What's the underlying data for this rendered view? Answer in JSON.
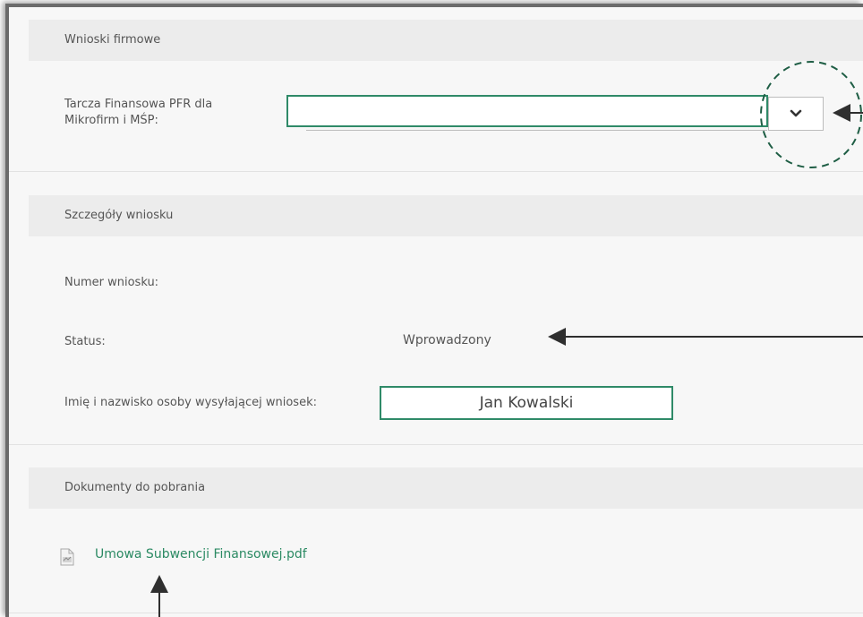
{
  "sections": {
    "company_applications": {
      "title": "Wnioski firmowe"
    },
    "application_details": {
      "title": "Szczegóły wniosku"
    },
    "documents": {
      "title": "Dokumenty do pobrania"
    }
  },
  "shield_select": {
    "label_line1": "Tarcza Finansowa PFR dla",
    "label_line2": "Mikrofirm i MŚP:",
    "value": "",
    "icon": "chevron-down-icon"
  },
  "details": {
    "number_label": "Numer wniosku:",
    "number_value": "",
    "status_label": "Status:",
    "status_value": "Wprowadzony",
    "sender_label": "Imię i nazwisko osoby wysyłającej wniosek:",
    "sender_value": "Jan Kowalski"
  },
  "documents": {
    "file_icon": "pdf-file-icon",
    "file_name": "Umowa Subwencji Finansowej.pdf"
  },
  "colors": {
    "accent_green": "#2f8a68",
    "link_green": "#2b8a63",
    "annotation": "#2f2f2f",
    "dashed_circle": "#1f5e45"
  }
}
